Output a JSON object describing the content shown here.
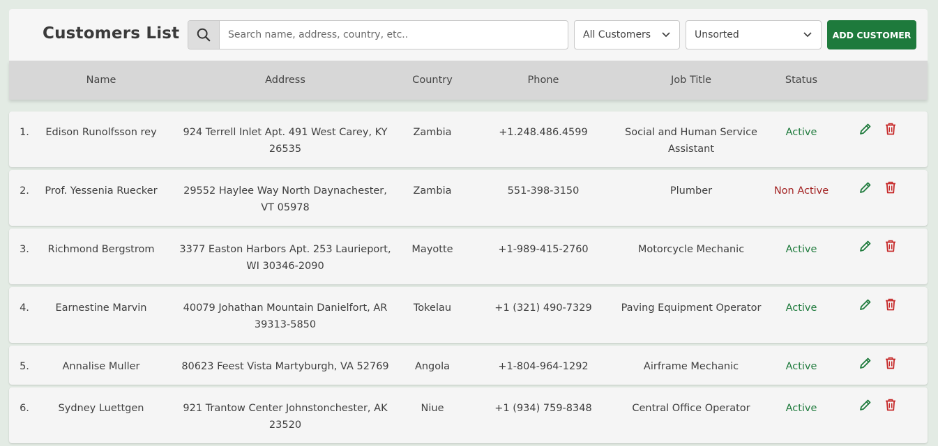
{
  "header": {
    "title": "Customers List",
    "search_placeholder": "Search name, address, country, etc..",
    "filter_label": "All Customers",
    "sort_label": "Unsorted",
    "add_button": "ADD CUSTOMER"
  },
  "columns": [
    "Name",
    "Address",
    "Country",
    "Phone",
    "Job Title",
    "Status"
  ],
  "colors": {
    "accent": "#1e7a3c",
    "active": "#1e7a3c",
    "non_active": "#a32323",
    "edit_icon": "#1e7a3c",
    "delete_icon": "#c62828"
  },
  "rows": [
    {
      "num": "1.",
      "name": "Edison Runolfsson rey",
      "address": "924 Terrell Inlet Apt. 491 West Carey, KY 26535",
      "country": "Zambia",
      "phone": "+1.248.486.4599",
      "job": "Social and Human Service Assistant",
      "status": "Active"
    },
    {
      "num": "2.",
      "name": "Prof. Yessenia Ruecker",
      "address": "29552 Haylee Way North Daynachester, VT 05978",
      "country": "Zambia",
      "phone": "551-398-3150",
      "job": "Plumber",
      "status": "Non Active"
    },
    {
      "num": "3.",
      "name": "Richmond Bergstrom",
      "address": "3377 Easton Harbors Apt. 253 Laurieport, WI 30346-2090",
      "country": "Mayotte",
      "phone": "+1-989-415-2760",
      "job": "Motorcycle Mechanic",
      "status": "Active"
    },
    {
      "num": "4.",
      "name": "Earnestine Marvin",
      "address": "40079 Johathan Mountain Danielfort, AR 39313-5850",
      "country": "Tokelau",
      "phone": "+1 (321) 490-7329",
      "job": "Paving Equipment Operator",
      "status": "Active"
    },
    {
      "num": "5.",
      "name": "Annalise Muller",
      "address": "80623 Feest Vista Martyburgh, VA 52769",
      "country": "Angola",
      "phone": "+1-804-964-1292",
      "job": "Airframe Mechanic",
      "status": "Active"
    },
    {
      "num": "6.",
      "name": "Sydney Luettgen",
      "address": "921 Trantow Center Johnstonchester, AK 23520",
      "country": "Niue",
      "phone": "+1 (934) 759-8348",
      "job": "Central Office Operator",
      "status": "Active"
    }
  ]
}
